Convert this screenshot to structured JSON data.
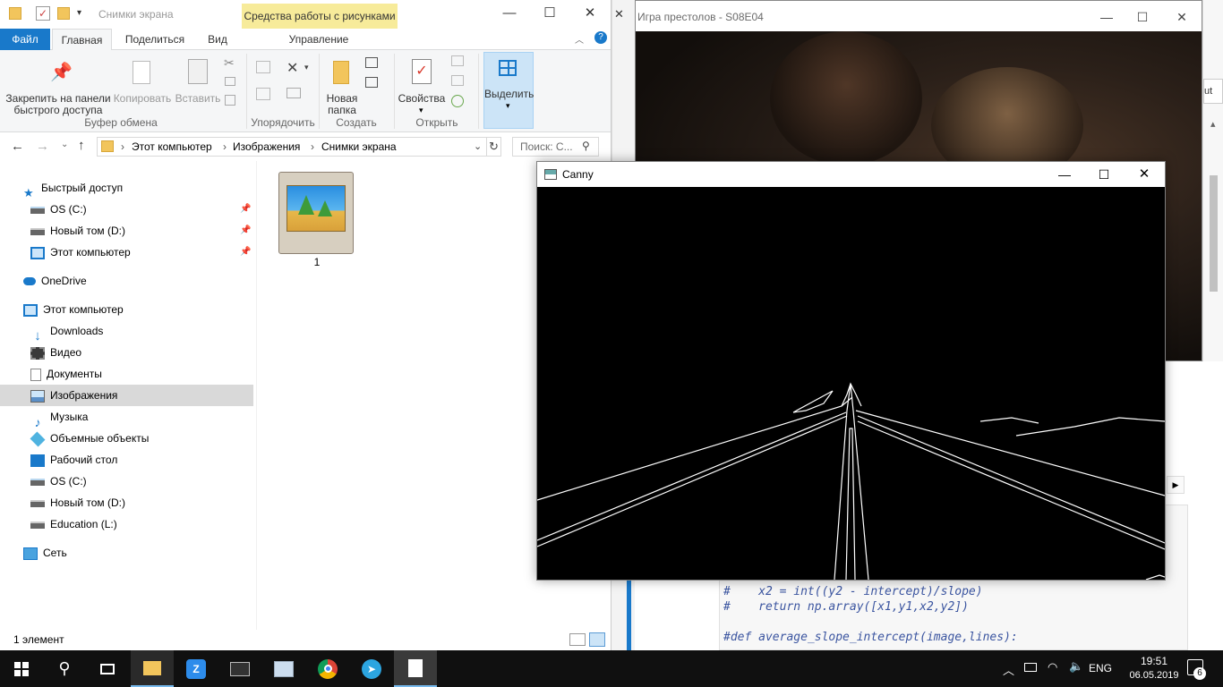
{
  "explorer": {
    "title": "Снимки экрана",
    "context_tab": "Средства работы с рисунками",
    "tabs": [
      "Файл",
      "Главная",
      "Поделиться",
      "Вид",
      "Управление"
    ],
    "ribbon": {
      "pin_label_1": "Закрепить на панели",
      "pin_label_2": "быстрого доступа",
      "copy": "Копировать",
      "paste": "Вставить",
      "new_folder_1": "Новая",
      "new_folder_2": "папка",
      "properties": "Свойства",
      "select": "Выделить",
      "groups": [
        "Буфер обмена",
        "Упорядочить",
        "Создать",
        "Открыть"
      ]
    },
    "breadcrumb": [
      "Этот компьютер",
      "Изображения",
      "Снимки экрана"
    ],
    "search_placeholder": "Поиск: С...",
    "nav": [
      {
        "label": "Быстрый доступ",
        "pinned": false
      },
      {
        "label": "OS (C:)",
        "pinned": true
      },
      {
        "label": "Новый том (D:)",
        "pinned": true
      },
      {
        "label": "Этот компьютер",
        "pinned": true
      },
      {
        "label": "OneDrive",
        "pinned": false
      },
      {
        "label": "Этот компьютер",
        "pinned": false
      },
      {
        "label": "Downloads",
        "pinned": false
      },
      {
        "label": "Видео",
        "pinned": false
      },
      {
        "label": "Документы",
        "pinned": false
      },
      {
        "label": "Изображения",
        "pinned": false,
        "selected": true
      },
      {
        "label": "Музыка",
        "pinned": false
      },
      {
        "label": "Объемные объекты",
        "pinned": false
      },
      {
        "label": "Рабочий стол",
        "pinned": false
      },
      {
        "label": "OS (C:)",
        "pinned": false
      },
      {
        "label": "Новый том (D:)",
        "pinned": false
      },
      {
        "label": "Education (L:)",
        "pinned": false
      },
      {
        "label": "Сеть",
        "pinned": false
      }
    ],
    "file_name": "1",
    "status": "1 элемент",
    "accent": "#1979ca"
  },
  "got": {
    "title": "Игра престолов - S08E04"
  },
  "editor": {
    "lines": [
      "#    x2 = int((y2 - intercept)/slope)",
      "#    return np.array([x1,y1,x2,y2])",
      "",
      "#def average_slope_intercept(image,lines):"
    ],
    "side_btn": "ut"
  },
  "canny": {
    "title": "Canny"
  },
  "taskbar": {
    "lang": "ENG",
    "time": "19:51",
    "date": "06.05.2019",
    "notifications": "6"
  }
}
